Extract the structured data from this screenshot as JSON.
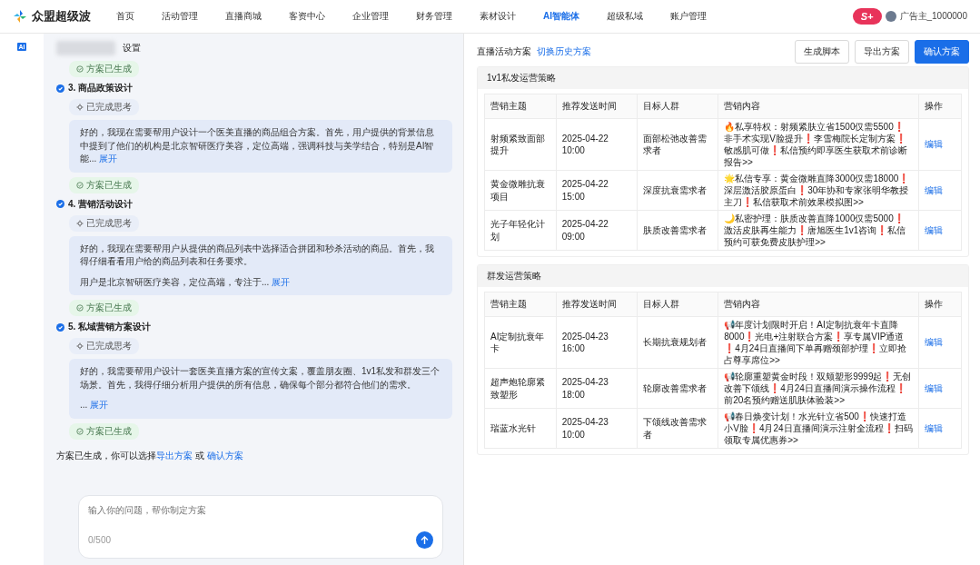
{
  "nav": {
    "logo": "众盟超级波",
    "items": [
      {
        "label": "首页",
        "selected": false
      },
      {
        "label": "活动管理",
        "selected": false
      },
      {
        "label": "直播商城",
        "selected": false
      },
      {
        "label": "客资中心",
        "selected": false
      },
      {
        "label": "企业管理",
        "selected": false
      },
      {
        "label": "财务管理",
        "selected": false
      },
      {
        "label": "素材设计",
        "selected": false
      },
      {
        "label": "AI智能体",
        "selected": true
      },
      {
        "label": "超级私域",
        "selected": false
      },
      {
        "label": "账户管理",
        "selected": false
      }
    ],
    "badge": "S+",
    "user": "广告主_1000000"
  },
  "rail": {
    "label": "AI"
  },
  "chat": {
    "header": {
      "title": "设置"
    },
    "leading_status": "方案已生成",
    "steps": [
      {
        "title": "3. 商品政策设计",
        "thinking": "已完成思考",
        "paragraphs": [
          "好的，我现在需要帮用户设计一个医美直播的商品组合方案。首先，用户提供的背景信息中提到了他们的机构是北京智研医疗美容，定位高端，强调科技与美学结合，特别是AI智能..."
        ],
        "more": "展开",
        "status": "方案已生成"
      },
      {
        "title": "4. 营销活动设计",
        "thinking": "已完成思考",
        "paragraphs": [
          "好的，我现在需要帮用户从提供的商品列表中选择适合拼团和秒杀活动的商品。首先，我得仔细看看用户给的商品列表和任务要求。",
          "用户是北京智研医疗美容，定位高端，专注于..."
        ],
        "more": "展开",
        "status": "方案已生成"
      },
      {
        "title": "5. 私域营销方案设计",
        "thinking": "已完成思考",
        "paragraphs": [
          "好的，我需要帮用户设计一套医美直播方案的宣传文案，覆盖朋友圈、1v1私发和群发三个场景。首先，我得仔细分析用户提供的所有信息，确保每个部分都符合他们的需求。",
          "..."
        ],
        "more": "展开",
        "status": "方案已生成"
      }
    ],
    "summary": {
      "text": "方案已生成，你可以选择",
      "link1": "导出方案",
      "joiner": "或",
      "link2": "确认方案"
    },
    "input": {
      "placeholder": "输入你的问题，帮你制定方案",
      "counter": "0/500"
    }
  },
  "plan": {
    "title": "直播活动方案",
    "switch_link": "切换历史方案",
    "buttons": [
      {
        "label": "生成脚本",
        "kind": "default"
      },
      {
        "label": "导出方案",
        "kind": "default"
      },
      {
        "label": "确认方案",
        "kind": "primary"
      }
    ],
    "sections": [
      {
        "title": "1v1私发运营策略",
        "columns": [
          "营销主题",
          "推荐发送时间",
          "目标人群",
          "营销内容",
          "操作"
        ],
        "rows": [
          {
            "topic": "射频紧致面部提升",
            "time": "2025-04-22 10:00",
            "audience": "面部松弛改善需求者",
            "content": "🔥私享特权：射频紧肤立省1500仅需5500❗非手术实现V脸提升❗李雪梅院长定制方案❗敏感肌可做❗私信预约即享医生获取术前诊断报告>>",
            "action": "编辑"
          },
          {
            "topic": "黄金微雕抗衰项目",
            "time": "2025-04-22 15:00",
            "audience": "深度抗衰需求者",
            "content": "🌟私信专享：黄金微雕直降3000仅需18000❗深层激活胶原蛋白❗30年协和专家张明华教授主刀❗私信获取术前效果模拟图>>",
            "action": "编辑"
          },
          {
            "topic": "光子年轻化计划",
            "time": "2025-04-22 09:00",
            "audience": "肤质改善需求者",
            "content": "🌙私密护理：肤质改善直降1000仅需5000❗激活皮肤再生能力❗唐旭医生1v1咨询❗私信预约可获免费皮肤护理>>",
            "action": "编辑"
          }
        ]
      },
      {
        "title": "群发运营策略",
        "columns": [
          "营销主题",
          "推荐发送时间",
          "目标人群",
          "营销内容",
          "操作"
        ],
        "rows": [
          {
            "topic": "AI定制抗衰年卡",
            "time": "2025-04-23 16:00",
            "audience": "长期抗衰规划者",
            "content": "📢年度计划限时开启！AI定制抗衰年卡直降8000❗光电+注射联合方案❗享专属VIP通道❗4月24日直播间下单再赠颈部护理❗立即抢占尊享席位>>",
            "action": "编辑"
          },
          {
            "topic": "超声炮轮廓紧致塑形",
            "time": "2025-04-23 18:00",
            "audience": "轮廓改善需求者",
            "content": "📢轮廓重塑黄金时段！双颊塑形9999起❗无创改善下颌线❗4月24日直播间演示操作流程❗前20名预约赠送肌肤体验装>>",
            "action": "编辑"
          },
          {
            "topic": "瑞蓝水光针",
            "time": "2025-04-23 10:00",
            "audience": "下颌线改善需求者",
            "content": "📢春日焕变计划！水光针立省500❗快速打造小V脸❗4月24日直播间演示注射全流程❗扫码领取专属优惠券>>",
            "action": "编辑"
          }
        ]
      }
    ]
  }
}
